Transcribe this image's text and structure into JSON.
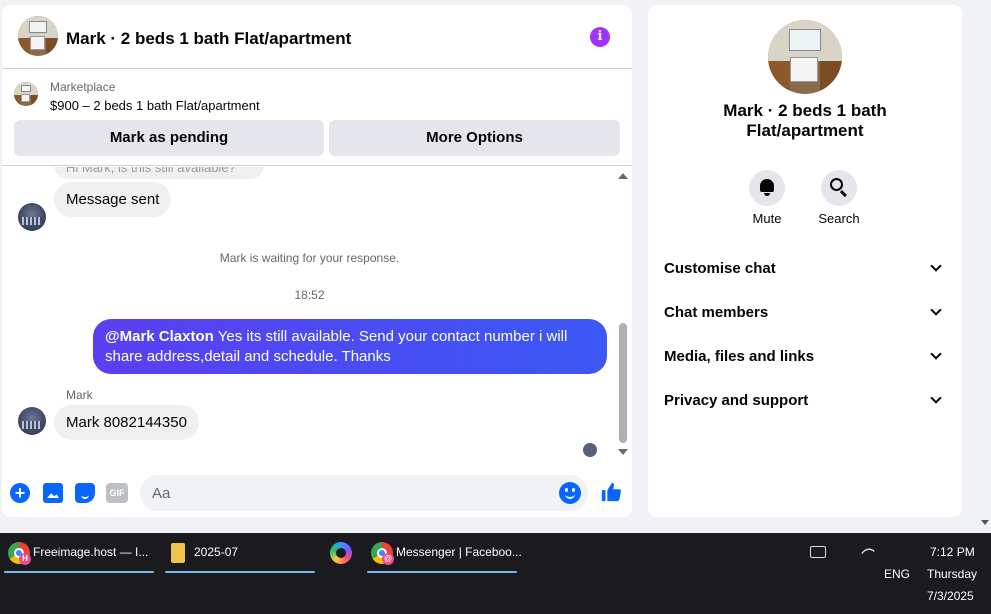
{
  "chat": {
    "header_title": "Mark · 2 beds 1 bath Flat/apartment",
    "info_icon": "i",
    "marketplace": {
      "label": "Marketplace",
      "listing": "$900 – 2 beds 1 bath Flat/apartment",
      "mark_pending": "Mark as pending",
      "more_options": "More Options"
    },
    "messages": {
      "partial_top": "Hi Mark, is this still available?",
      "sent_notice": "Message sent",
      "waiting_note": "Mark is waiting for your response.",
      "timestamp": "18:52",
      "outgoing_mention": "@Mark Claxton",
      "outgoing_text": " Yes its still available. Send your contact number i will share address,detail and schedule. Thanks",
      "sender_name": "Mark",
      "incoming_text": "Mark 8082144350"
    },
    "composer": {
      "placeholder": "Aa",
      "plus_icon": "plus-circle-icon",
      "photo_icon": "photo-icon",
      "sticker_icon": "sticker-icon",
      "gif_label": "GIF",
      "emoji_icon": "emoji-icon",
      "like_icon": "thumbs-up-icon"
    }
  },
  "info_panel": {
    "title": "Mark · 2 beds 1 bath Flat/apartment",
    "mute_label": "Mute",
    "search_label": "Search",
    "sections": [
      {
        "label": "Customise chat"
      },
      {
        "label": "Chat members"
      },
      {
        "label": "Media, files and links"
      },
      {
        "label": "Privacy and support"
      }
    ]
  },
  "taskbar": {
    "items": [
      {
        "label": "Freeimage.host — I...",
        "icon": "chrome-icon",
        "badge": "H"
      },
      {
        "label": "2025-07",
        "icon": "folder-icon"
      },
      {
        "label": "Messenger | Faceboo...",
        "icon": "chrome-icon",
        "badge": "@"
      }
    ],
    "tray": {
      "language": "ENG",
      "time": "7:12 PM",
      "day": "Thursday",
      "date": "7/3/2025"
    }
  },
  "colors": {
    "accent": "#0866ff",
    "outgoing_bubble": "#4f4df5",
    "info_icon": "#a033ff",
    "taskbar": "#1b1b1f"
  }
}
